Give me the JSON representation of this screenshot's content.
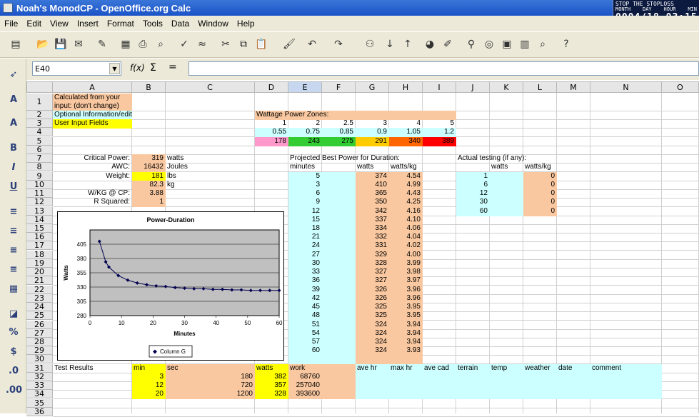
{
  "window": {
    "title": "Noah's MonodCP - OpenOffice.org Calc"
  },
  "clock": {
    "title": "STOP THE STOPLOSS",
    "h_month": "MONTH",
    "h_day": "DAY",
    "h_hour": "HOUR",
    "h_min": "MIN",
    "value": "0004/18 03:15"
  },
  "menu": {
    "file": "File",
    "edit": "Edit",
    "view": "View",
    "insert": "Insert",
    "format": "Format",
    "tools": "Tools",
    "data": "Data",
    "window": "Window",
    "help": "Help"
  },
  "formula": {
    "cell_ref": "E40",
    "fx": "f(x)",
    "sigma": "Σ",
    "equals": "=",
    "content": ""
  },
  "columns": [
    "A",
    "B",
    "C",
    "D",
    "E",
    "F",
    "G",
    "H",
    "I",
    "J",
    "K",
    "L",
    "M",
    "N",
    "O"
  ],
  "rows": [
    "1",
    "2",
    "3",
    "4",
    "5",
    "6",
    "7",
    "8",
    "9",
    "10",
    "11",
    "12",
    "13",
    "14",
    "15",
    "16",
    "17",
    "18",
    "19",
    "20",
    "21",
    "22",
    "23",
    "24",
    "25",
    "26",
    "27",
    "28",
    "29",
    "30",
    "31",
    "32",
    "33",
    "34",
    "35",
    "36"
  ],
  "legend_notes": {
    "a1_l1": "Calculated from your",
    "a1_l2": "input: (don't change)",
    "a2": "Optional Information/edit",
    "a3": "User Input Fields"
  },
  "zones": {
    "title": "Wattage Power Zones:",
    "row3": [
      "1",
      "2",
      "2.5",
      "3",
      "4",
      "5"
    ],
    "row4": [
      "0.55",
      "0.75",
      "0.85",
      "0.9",
      "1.05",
      "1.2"
    ],
    "row5": [
      "178",
      "243",
      "275",
      "291",
      "340",
      "389"
    ]
  },
  "params": {
    "cp_label": "Critical Power:",
    "cp_val": "319",
    "cp_unit": "watts",
    "awc_label": "AWC:",
    "awc_val": "16432",
    "awc_unit": "Joules",
    "wt_label": "Weight:",
    "wt_val": "181",
    "wt_unit": "lbs",
    "kg_val": "82.3",
    "kg_unit": "kg",
    "wkg_label": "W/KG @ CP:",
    "wkg_val": "3.88",
    "r2_label": "R Squared:",
    "r2_val": "1"
  },
  "projected": {
    "title": "Projected Best Power for Duration:",
    "h_min": "minutes",
    "h_watts": "watts",
    "h_wkg": "watts/kg",
    "minutes": [
      "5",
      "3",
      "6",
      "9",
      "12",
      "15",
      "18",
      "21",
      "24",
      "27",
      "30",
      "33",
      "36",
      "39",
      "42",
      "45",
      "48",
      "51",
      "54",
      "57",
      "60"
    ],
    "watts": [
      "374",
      "410",
      "365",
      "350",
      "342",
      "337",
      "334",
      "332",
      "331",
      "329",
      "328",
      "327",
      "327",
      "326",
      "326",
      "325",
      "325",
      "324",
      "324",
      "324",
      "324"
    ],
    "wkg": [
      "4.54",
      "4.99",
      "4.43",
      "4.25",
      "4.16",
      "4.10",
      "4.06",
      "4.04",
      "4.02",
      "4.00",
      "3.99",
      "3.98",
      "3.97",
      "3.96",
      "3.96",
      "3.95",
      "3.95",
      "3.94",
      "3.94",
      "3.94",
      "3.93"
    ]
  },
  "actual": {
    "title": "Actual testing (if any):",
    "h_watts": "watts",
    "h_wkg": "watts/kg",
    "minutes": [
      "1",
      "6",
      "12",
      "30",
      "60"
    ],
    "wkg": [
      "0",
      "0",
      "0",
      "0",
      "0"
    ]
  },
  "tests": {
    "title": "Test Results",
    "headers": [
      "min",
      "sec",
      "watts",
      "work",
      "ave hr",
      "max hr",
      "ave cad",
      "terrain",
      "temp",
      "weather",
      "date",
      "comment"
    ],
    "rows": [
      {
        "min": "3",
        "sec": "180",
        "watts": "382",
        "work": "68760"
      },
      {
        "min": "12",
        "sec": "720",
        "watts": "357",
        "work": "257040"
      },
      {
        "min": "20",
        "sec": "1200",
        "watts": "328",
        "work": "393600"
      }
    ]
  },
  "chart_data": {
    "type": "scatter",
    "title": "Power-Duration",
    "xlabel": "Minutes",
    "ylabel": "Watts",
    "xlim": [
      0,
      60
    ],
    "ylim": [
      280,
      430
    ],
    "xticks": [
      0,
      10,
      20,
      30,
      40,
      50,
      60
    ],
    "yticks": [
      280,
      305,
      330,
      355,
      380,
      405
    ],
    "grid": true,
    "legend": "bottom",
    "series": [
      {
        "name": "Column G",
        "x": [
          3,
          5,
          6,
          9,
          12,
          15,
          18,
          21,
          24,
          27,
          30,
          33,
          36,
          39,
          42,
          45,
          48,
          51,
          54,
          57,
          60
        ],
        "y": [
          410,
          374,
          365,
          350,
          342,
          337,
          334,
          332,
          331,
          329,
          328,
          327,
          327,
          326,
          326,
          325,
          325,
          324,
          324,
          324,
          324
        ]
      }
    ]
  },
  "colors": {
    "peach": "#f9c8a0",
    "yellow": "#ffff00",
    "cyan": "#ccffff",
    "z1": "#ff99cc",
    "z2": "#33cc33",
    "z3": "#33cc33",
    "z4": "#ffcc00",
    "z5": "#ff6600",
    "z6": "#ff0000",
    "plot": "#c0c0c0"
  }
}
